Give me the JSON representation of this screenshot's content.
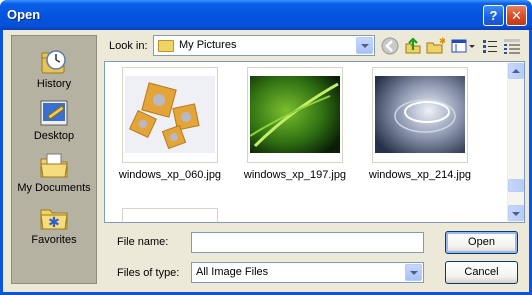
{
  "window": {
    "title": "Open"
  },
  "places": [
    {
      "label": "History",
      "icon": "history-icon"
    },
    {
      "label": "Desktop",
      "icon": "desktop-icon"
    },
    {
      "label": "My Documents",
      "icon": "my-documents-icon"
    },
    {
      "label": "Favorites",
      "icon": "favorites-icon"
    }
  ],
  "lookin": {
    "label": "Look in:",
    "value": "My Pictures"
  },
  "toolbar": [
    "back-icon",
    "up-folder-icon",
    "new-folder-icon",
    "views-icon",
    "list-view-icon",
    "details-view-icon"
  ],
  "files": [
    {
      "name": "windows_xp_060.jpg"
    },
    {
      "name": "windows_xp_197.jpg"
    },
    {
      "name": "windows_xp_214.jpg"
    }
  ],
  "filename": {
    "label": "File name:",
    "value": ""
  },
  "filetype": {
    "label": "Files of type:",
    "value": "All Image Files"
  },
  "buttons": {
    "open": "Open",
    "cancel": "Cancel"
  },
  "colors": {
    "titlebar": "#0653de",
    "dialog_bg": "#ece9d8",
    "places_bg": "#b5b2a2",
    "close": "#d44a21"
  }
}
